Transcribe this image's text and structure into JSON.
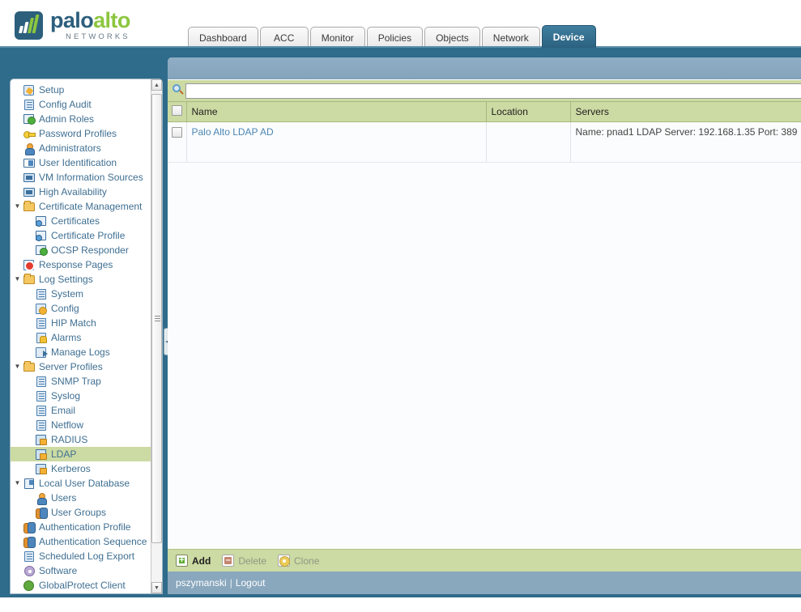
{
  "brand": {
    "word_primary": "palo",
    "word_accent": "alto",
    "subtitle": "NETWORKS",
    "logo_name": "palo-alto-networks-logo"
  },
  "tabs": [
    {
      "label": "Dashboard",
      "active": false
    },
    {
      "label": "ACC",
      "active": false
    },
    {
      "label": "Monitor",
      "active": false
    },
    {
      "label": "Policies",
      "active": false
    },
    {
      "label": "Objects",
      "active": false
    },
    {
      "label": "Network",
      "active": false
    },
    {
      "label": "Device",
      "active": true
    }
  ],
  "sidebar": {
    "items": [
      {
        "label": "Setup",
        "level": 1,
        "icon": "wrench-icon",
        "twisty": "",
        "selected": false
      },
      {
        "label": "Config Audit",
        "level": 1,
        "icon": "config-audit-icon",
        "twisty": "",
        "selected": false
      },
      {
        "label": "Admin Roles",
        "level": 1,
        "icon": "admin-roles-icon",
        "twisty": "",
        "selected": false
      },
      {
        "label": "Password Profiles",
        "level": 1,
        "icon": "key-icon",
        "twisty": "",
        "selected": false
      },
      {
        "label": "Administrators",
        "level": 1,
        "icon": "person-icon",
        "twisty": "",
        "selected": false
      },
      {
        "label": "User Identification",
        "level": 1,
        "icon": "badge-icon",
        "twisty": "",
        "selected": false
      },
      {
        "label": "VM Information Sources",
        "level": 1,
        "icon": "screen-icon",
        "twisty": "",
        "selected": false
      },
      {
        "label": "High Availability",
        "level": 1,
        "icon": "screen-icon",
        "twisty": "",
        "selected": false
      },
      {
        "label": "Certificate Management",
        "level": 1,
        "icon": "folder-icon",
        "twisty": "▼",
        "selected": false
      },
      {
        "label": "Certificates",
        "level": 2,
        "icon": "certificate-icon",
        "twisty": "",
        "selected": false
      },
      {
        "label": "Certificate Profile",
        "level": 2,
        "icon": "certificate-icon",
        "twisty": "",
        "selected": false
      },
      {
        "label": "OCSP Responder",
        "level": 2,
        "icon": "ocsp-check-icon",
        "twisty": "",
        "selected": false
      },
      {
        "label": "Response Pages",
        "level": 1,
        "icon": "deny-icon",
        "twisty": "",
        "selected": false
      },
      {
        "label": "Log Settings",
        "level": 1,
        "icon": "folder-doc-icon",
        "twisty": "▼",
        "selected": false
      },
      {
        "label": "System",
        "level": 2,
        "icon": "log-system-icon",
        "twisty": "",
        "selected": false
      },
      {
        "label": "Config",
        "level": 2,
        "icon": "log-config-icon",
        "twisty": "",
        "selected": false
      },
      {
        "label": "HIP Match",
        "level": 2,
        "icon": "log-system-icon",
        "twisty": "",
        "selected": false
      },
      {
        "label": "Alarms",
        "level": 2,
        "icon": "bell-icon",
        "twisty": "",
        "selected": false
      },
      {
        "label": "Manage Logs",
        "level": 2,
        "icon": "manage-logs-icon",
        "twisty": "",
        "selected": false
      },
      {
        "label": "Server Profiles",
        "level": 1,
        "icon": "folder-icon",
        "twisty": "▼",
        "selected": false
      },
      {
        "label": "SNMP Trap",
        "level": 2,
        "icon": "server-icon",
        "twisty": "",
        "selected": false
      },
      {
        "label": "Syslog",
        "level": 2,
        "icon": "server-icon",
        "twisty": "",
        "selected": false
      },
      {
        "label": "Email",
        "level": 2,
        "icon": "server-icon",
        "twisty": "",
        "selected": false
      },
      {
        "label": "Netflow",
        "level": 2,
        "icon": "server-icon",
        "twisty": "",
        "selected": false
      },
      {
        "label": "RADIUS",
        "level": 2,
        "icon": "server-lock-icon",
        "twisty": "",
        "selected": false
      },
      {
        "label": "LDAP",
        "level": 2,
        "icon": "server-lock-icon",
        "twisty": "",
        "selected": true
      },
      {
        "label": "Kerberos",
        "level": 2,
        "icon": "server-lock-icon",
        "twisty": "",
        "selected": false
      },
      {
        "label": "Local User Database",
        "level": 1,
        "icon": "database-icon",
        "twisty": "▼",
        "selected": false
      },
      {
        "label": "Users",
        "level": 2,
        "icon": "person-icon",
        "twisty": "",
        "selected": false
      },
      {
        "label": "User Groups",
        "level": 2,
        "icon": "people-icon",
        "twisty": "",
        "selected": false
      },
      {
        "label": "Authentication Profile",
        "level": 1,
        "icon": "people-icon",
        "twisty": "",
        "selected": false
      },
      {
        "label": "Authentication Sequence",
        "level": 1,
        "icon": "auth-sequence-icon",
        "twisty": "",
        "selected": false
      },
      {
        "label": "Scheduled Log Export",
        "level": 1,
        "icon": "doc-icon",
        "twisty": "",
        "selected": false
      },
      {
        "label": "Software",
        "level": 1,
        "icon": "disc-icon",
        "twisty": "",
        "selected": false
      },
      {
        "label": "GlobalProtect Client",
        "level": 1,
        "icon": "globe-icon",
        "twisty": "",
        "selected": false
      }
    ],
    "scroll_up_glyph": "▲",
    "scroll_down_glyph": "▼",
    "collapse_glyph": "◀"
  },
  "search": {
    "value": "",
    "placeholder": "",
    "icon": "search-icon"
  },
  "table": {
    "columns": [
      {
        "key": "name",
        "label": "Name"
      },
      {
        "key": "location",
        "label": "Location"
      },
      {
        "key": "servers",
        "label": "Servers"
      }
    ],
    "rows": [
      {
        "name": "Palo Alto LDAP AD",
        "location": "",
        "servers": "Name: pnad1 LDAP Server: 192.168.1.35 Port: 389",
        "checked": false
      }
    ]
  },
  "actions": [
    {
      "label": "Add",
      "icon": "plus-icon",
      "enabled": true
    },
    {
      "label": "Delete",
      "icon": "minus-icon",
      "enabled": false
    },
    {
      "label": "Clone",
      "icon": "clone-icon",
      "enabled": false
    }
  ],
  "status": {
    "user": "pszymanski",
    "separator": "|",
    "logout_label": "Logout"
  },
  "colors": {
    "brand_blue": "#2c5f7c",
    "brand_green": "#8cc63e",
    "body_blue": "#2f6b8a",
    "header_band": "#8fadc4",
    "olive": "#ccdaa3",
    "selection": "#ccdaa3",
    "link": "#4b86b4",
    "statusbar": "#89a7bd"
  }
}
